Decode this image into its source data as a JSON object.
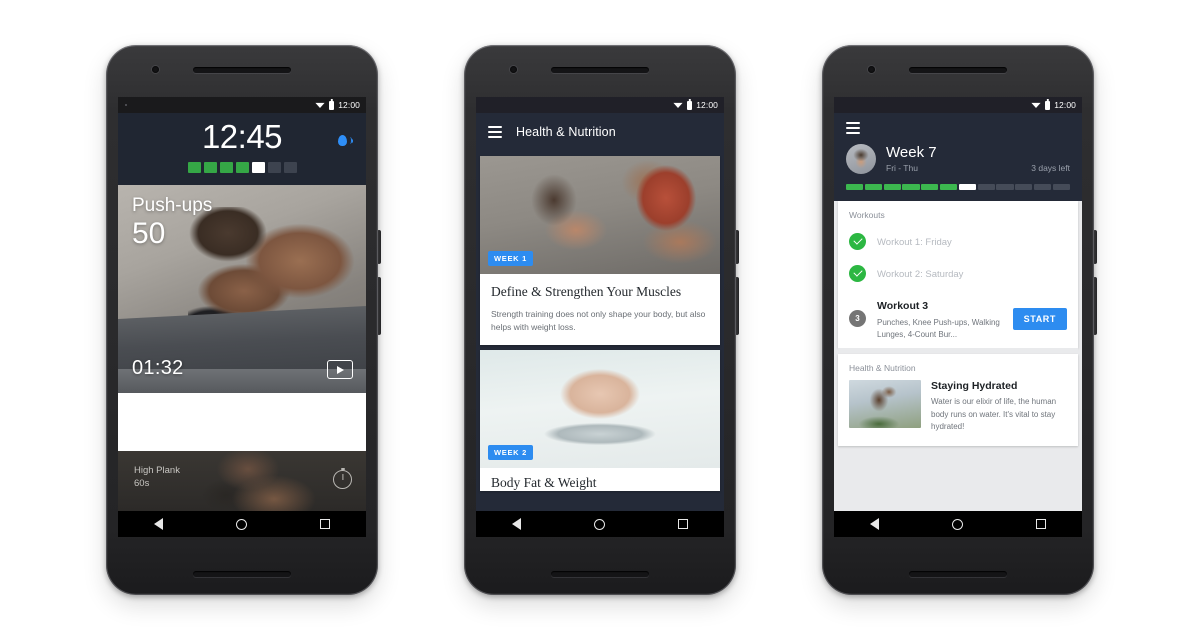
{
  "phones": [
    {
      "id": "workout-player",
      "statusbar": {
        "time": "12:00",
        "wifi_icon": "wifi-icon",
        "battery_icon": "battery-icon"
      },
      "header": {
        "clock": "12:45",
        "sensor_icon": "heart-rate-sensor-icon",
        "progress_segments": [
          "green",
          "green",
          "green",
          "green",
          "white",
          "gray",
          "gray"
        ],
        "colors": {
          "green": "#35a746",
          "white": "#ffffff",
          "gray": "#3d434f"
        }
      },
      "hero": {
        "exercise_name": "Push-ups",
        "reps": "50",
        "timer": "01:32",
        "play_icon": "play-button-icon"
      },
      "next_up": {
        "name": "High Plank",
        "duration": "60s",
        "timer_icon": "stopwatch-icon"
      },
      "navbar": {
        "back_icon": "back-triangle-icon",
        "home_icon": "home-circle-icon",
        "recents_icon": "recents-square-icon"
      }
    },
    {
      "id": "health-nutrition-feed",
      "statusbar": {
        "time": "12:00",
        "wifi_icon": "wifi-icon",
        "battery_icon": "battery-icon"
      },
      "appbar": {
        "menu_icon": "hamburger-menu-icon",
        "title": "Health & Nutrition"
      },
      "cards": [
        {
          "badge": "WEEK 1",
          "image": "plank-couple-photo",
          "title": "Define & Strengthen Your Muscles",
          "body": "Strength training does not only shape your body, but also helps with weight loss."
        },
        {
          "badge": "WEEK 2",
          "image": "feet-on-scale-photo",
          "title": "Body Fat & Weight",
          "body": ""
        }
      ],
      "navbar": {
        "back_icon": "back-triangle-icon",
        "home_icon": "home-circle-icon",
        "recents_icon": "recents-square-icon"
      }
    },
    {
      "id": "week-overview",
      "statusbar": {
        "time": "12:00",
        "wifi_icon": "wifi-icon",
        "battery_icon": "battery-icon"
      },
      "appbar": {
        "menu_icon": "hamburger-menu-icon"
      },
      "header": {
        "avatar": "user-avatar",
        "week_title": "Week 7",
        "date_range": "Fri - Thu",
        "days_left": "3 days left",
        "progress_segments": [
          "green",
          "green",
          "green",
          "green",
          "green",
          "green",
          "white",
          "gray",
          "gray",
          "gray",
          "gray",
          "gray"
        ],
        "colors": {
          "green": "#3cb84f",
          "white": "#ffffff",
          "gray": "#454b58"
        }
      },
      "workouts_section": {
        "label": "Workouts",
        "items": [
          {
            "badge": "check",
            "number": "",
            "name": "Workout 1: Friday",
            "subtitle": "",
            "state": "done",
            "action": ""
          },
          {
            "badge": "check",
            "number": "",
            "name": "Workout 2: Saturday",
            "subtitle": "",
            "state": "done",
            "action": ""
          },
          {
            "badge": "number",
            "number": "3",
            "name": "Workout 3",
            "subtitle": "Punches, Knee Push-ups, Walking Lunges, 4-Count Bur...",
            "state": "current",
            "action": "START"
          }
        ]
      },
      "nutrition_section": {
        "label": "Health & Nutrition",
        "item": {
          "image": "man-drinking-water-photo",
          "title": "Staying Hydrated",
          "body": "Water is our elixir of life, the human body runs on water. It's vital to stay hydrated!"
        }
      },
      "navbar": {
        "back_icon": "back-triangle-icon",
        "home_icon": "home-circle-icon",
        "recents_icon": "recents-square-icon"
      }
    }
  ]
}
